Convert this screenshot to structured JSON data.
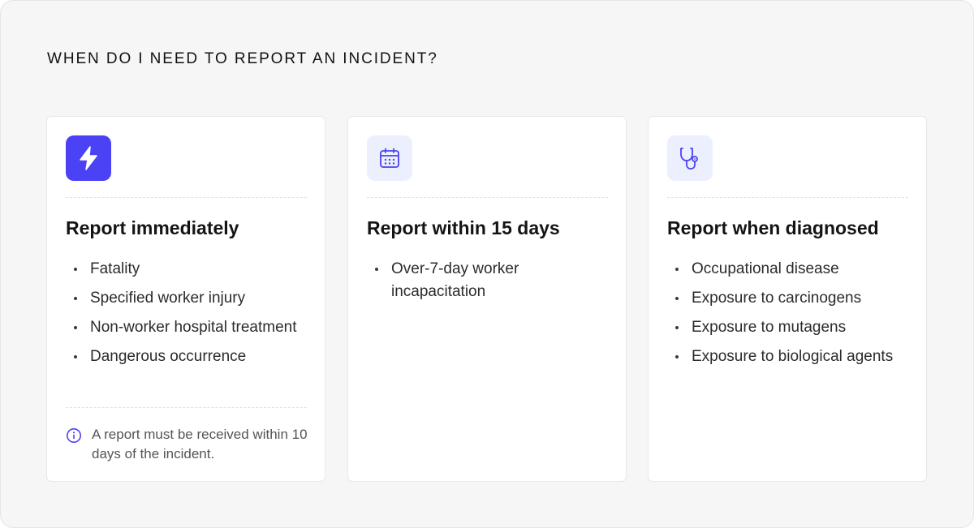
{
  "heading": "WHEN DO I NEED TO REPORT AN INCIDENT?",
  "colors": {
    "accent": "#4b42f5",
    "soft_tile": "#eceffd",
    "panel_bg": "#f6f6f6"
  },
  "cards": [
    {
      "icon": "lightning-icon",
      "title": "Report immediately",
      "items": [
        "Fatality",
        "Specified worker injury",
        "Non-worker hospital treatment",
        "Dangerous occurrence"
      ],
      "note": {
        "icon": "info-icon",
        "text": "A report must be received within 10 days of the incident."
      }
    },
    {
      "icon": "calendar-icon",
      "title": "Report within 15 days",
      "items": [
        "Over-7-day worker incapacitation"
      ]
    },
    {
      "icon": "stethoscope-icon",
      "title": "Report when diagnosed",
      "items": [
        "Occupational disease",
        "Exposure to carcinogens",
        "Exposure to mutagens",
        "Exposure to biological agents"
      ]
    }
  ]
}
